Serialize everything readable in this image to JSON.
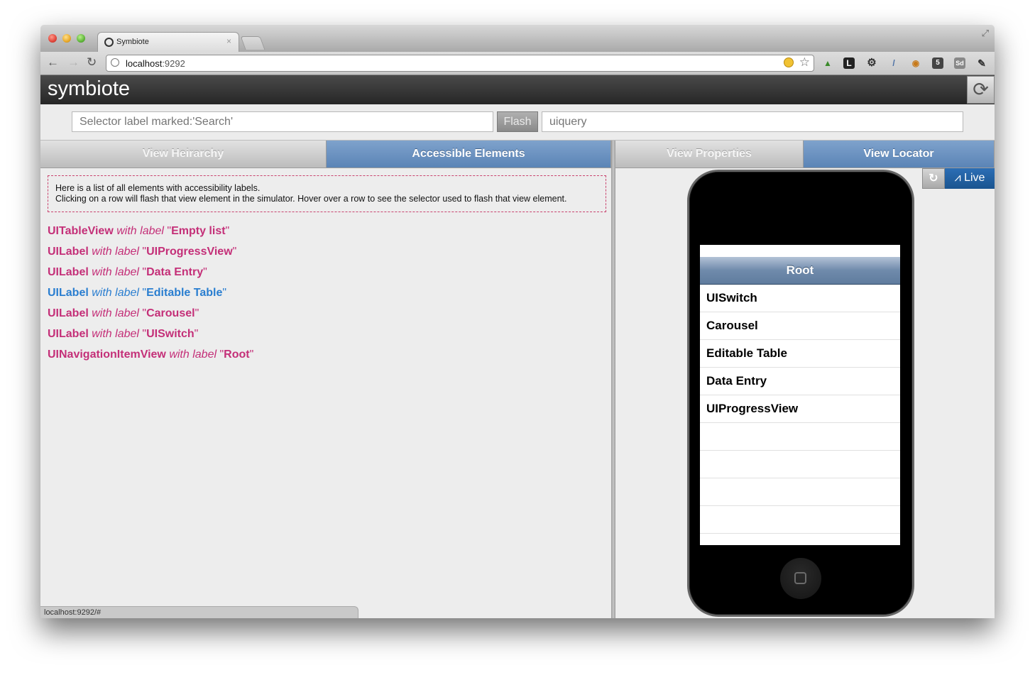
{
  "browser": {
    "tab_title": "Symbiote",
    "tab_close": "×",
    "url_host": "localhost",
    "url_port": ":9292",
    "status_url": "localhost:9292/#",
    "extensions": [
      "evernote-icon",
      "L",
      "gear-icon",
      "eyedropper-icon",
      "search-icon",
      "5",
      "Sd",
      "wrench-icon"
    ]
  },
  "app": {
    "title": "symbiote",
    "selector_placeholder": "Selector label marked:'Search'",
    "flash_label": "Flash",
    "uiquery_placeholder": "uiquery"
  },
  "tabs": {
    "view_hierarchy": "View Heirarchy",
    "accessible_elements": "Accessible Elements",
    "view_properties": "View Properties",
    "view_locator": "View Locator"
  },
  "notice": {
    "line1": "Here is a list of all elements with accessibility labels.",
    "line2": "Clicking on a row will flash that view element in the simulator. Hover over a row to see the selector used to flash that view element."
  },
  "elements": [
    {
      "cls": "UITableView",
      "with": "with label",
      "label": "Empty list"
    },
    {
      "cls": "UILabel",
      "with": "with label",
      "label": "UIProgressView"
    },
    {
      "cls": "UILabel",
      "with": "with label",
      "label": "Data Entry"
    },
    {
      "cls": "UILabel",
      "with": "with label",
      "label": "Editable Table"
    },
    {
      "cls": "UILabel",
      "with": "with label",
      "label": "Carousel"
    },
    {
      "cls": "UILabel",
      "with": "with label",
      "label": "UISwitch"
    },
    {
      "cls": "UINavigationItemView",
      "with": "with label",
      "label": "Root"
    }
  ],
  "locator": {
    "refresh_icon": "↻",
    "live_label": "Live",
    "nav_title": "Root",
    "rows": [
      "UISwitch",
      "Carousel",
      "Editable Table",
      "Data Entry",
      "UIProgressView",
      "",
      "",
      "",
      ""
    ]
  },
  "colors": {
    "element_class": "#c42f78",
    "element_hover": "#2a7ed0",
    "active_tab": "#6a91c1",
    "live_button": "#1f5f9f"
  }
}
